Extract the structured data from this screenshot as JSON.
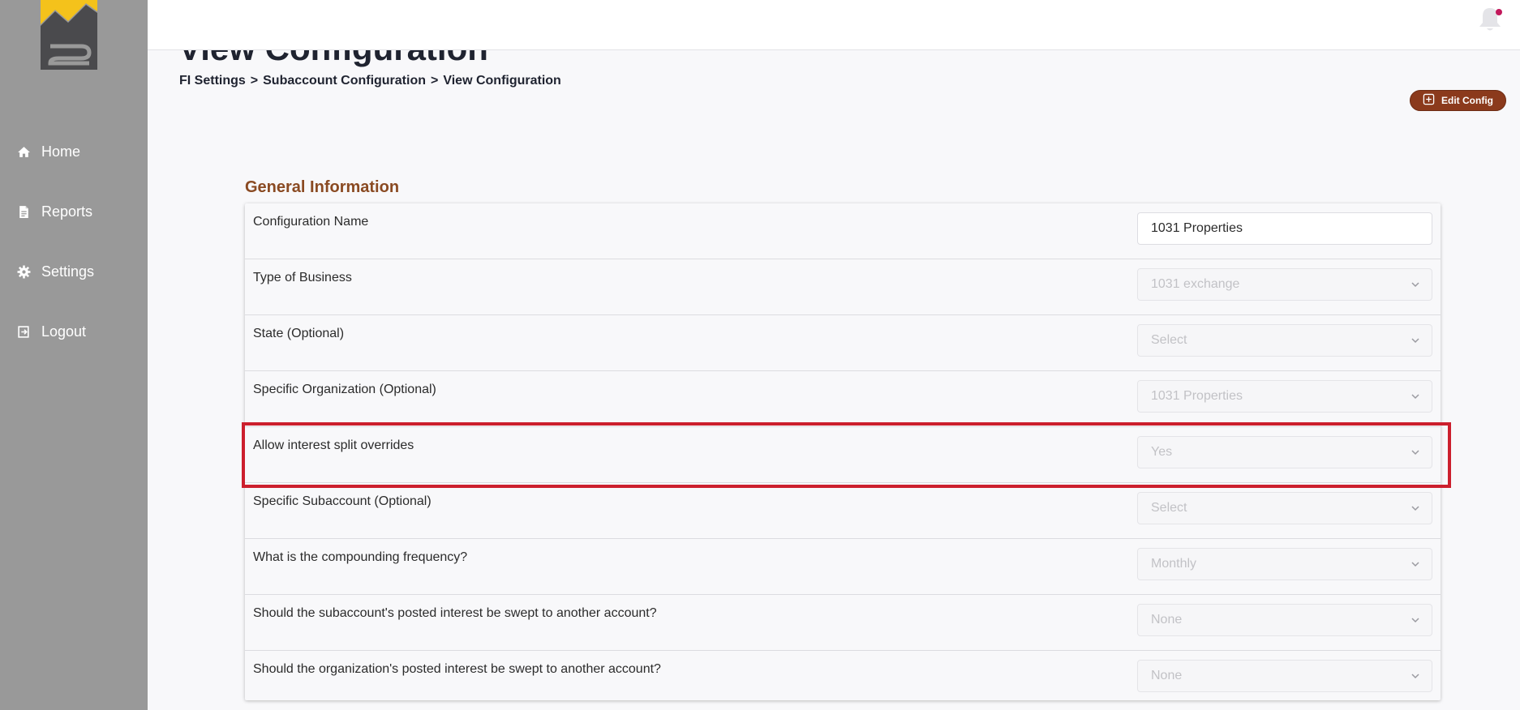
{
  "header": {
    "page_title": "View Configuration",
    "breadcrumb": [
      "FI Settings",
      "Subaccount Configuration",
      "View Configuration"
    ],
    "breadcrumb_separator": ">"
  },
  "sidebar": {
    "items": [
      {
        "label": "Home",
        "icon": "home-icon"
      },
      {
        "label": "Reports",
        "icon": "document-icon"
      },
      {
        "label": "Settings",
        "icon": "gear-icon"
      },
      {
        "label": "Logout",
        "icon": "logout-icon"
      }
    ]
  },
  "actions": {
    "edit_label": "Edit Config"
  },
  "section": {
    "title": "General Information",
    "rows": [
      {
        "label": "Configuration Name",
        "value": "1031 Properties",
        "kind": "text"
      },
      {
        "label": "Type of Business",
        "value": "1031 exchange",
        "kind": "select"
      },
      {
        "label": "State (Optional)",
        "value": "Select",
        "kind": "select"
      },
      {
        "label": "Specific Organization (Optional)",
        "value": "1031 Properties",
        "kind": "select"
      },
      {
        "label": "Allow interest split overrides",
        "value": "Yes",
        "kind": "select"
      },
      {
        "label": "Specific Subaccount (Optional)",
        "value": "Select",
        "kind": "select"
      },
      {
        "label": "What is the compounding frequency?",
        "value": "Monthly",
        "kind": "select"
      },
      {
        "label": "Should the subaccount's posted interest be swept to another account?",
        "value": "None",
        "kind": "select"
      },
      {
        "label": "Should the organization's posted interest be swept to another account?",
        "value": "None",
        "kind": "select"
      }
    ]
  },
  "colors": {
    "sidebar_bg": "#999999",
    "accent": "#8b3a1c",
    "section_title": "#8a4a22",
    "highlight": "#cc1f2d",
    "notification_dot": "#c2185b"
  }
}
